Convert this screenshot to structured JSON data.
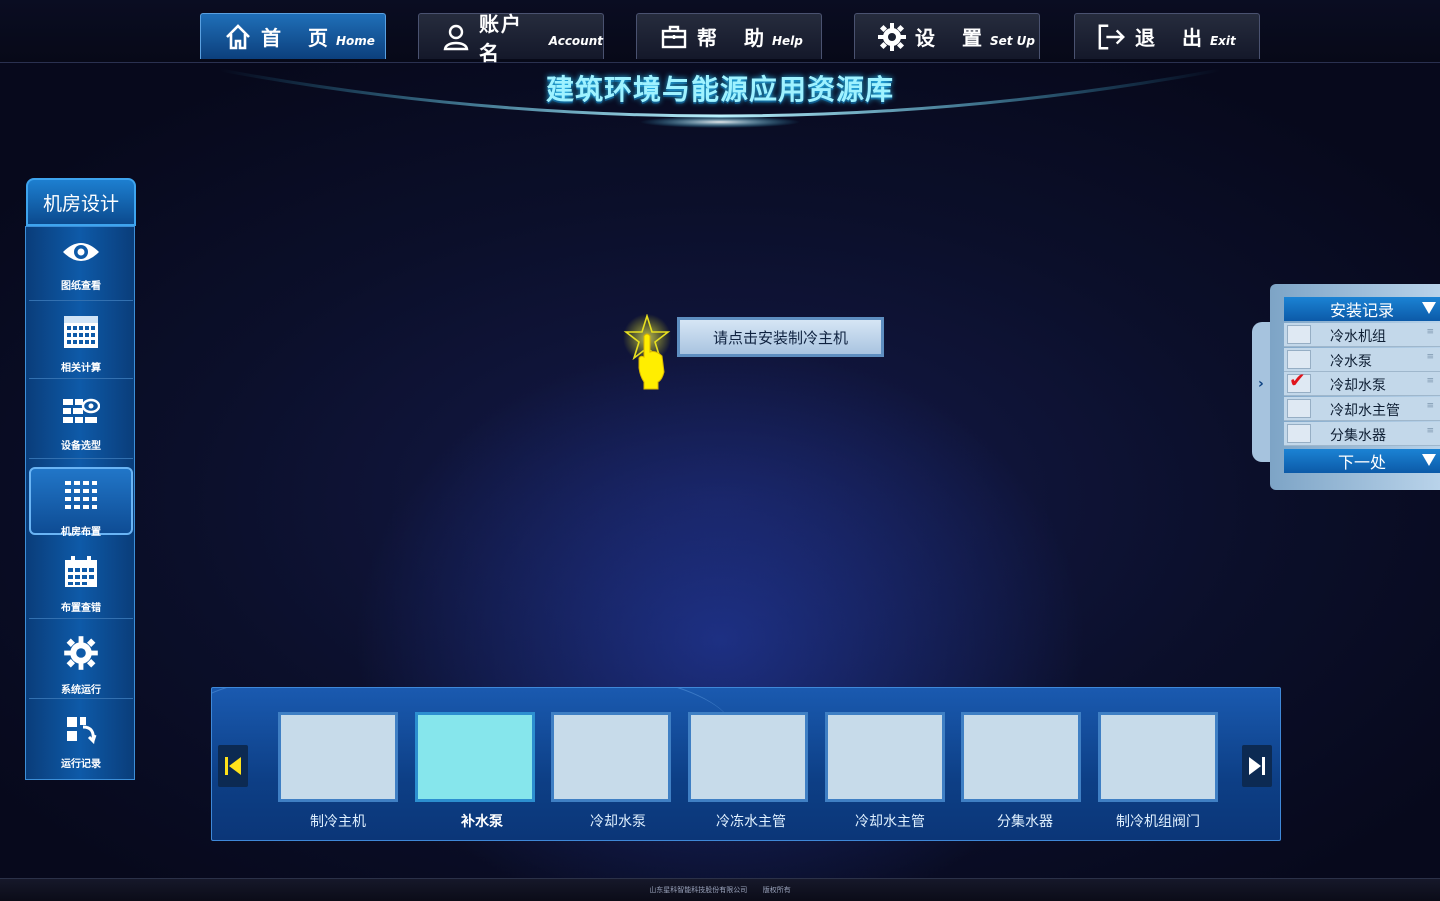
{
  "nav": {
    "items": [
      {
        "zh": "首 页",
        "en": "Home",
        "icon": "home-icon",
        "active": true
      },
      {
        "zh": "账户名",
        "en": "Account",
        "icon": "user-icon",
        "active": false
      },
      {
        "zh": "帮 助",
        "en": "Help",
        "icon": "briefcase-icon",
        "active": false
      },
      {
        "zh": "设 置",
        "en": "Set Up",
        "icon": "gear-icon",
        "active": false
      },
      {
        "zh": "退 出",
        "en": "Exit",
        "icon": "exit-icon",
        "active": false
      }
    ]
  },
  "title": "建筑环境与能源应用资源库",
  "sidebar": {
    "header": "机房设计",
    "items": [
      {
        "label": "图纸查看",
        "icon": "eye-icon"
      },
      {
        "label": "相关计算",
        "icon": "calculator-icon"
      },
      {
        "label": "设备选型",
        "icon": "equipment-select-icon"
      },
      {
        "label": "机房布置",
        "icon": "layout-grid-icon",
        "active": true
      },
      {
        "label": "布置查错",
        "icon": "calendar-icon"
      },
      {
        "label": "系统运行",
        "icon": "gear-icon"
      },
      {
        "label": "运行记录",
        "icon": "record-icon"
      }
    ]
  },
  "prompt": {
    "text": "请点击安装制冷主机",
    "icon": "pointing-hand-icon"
  },
  "install_panel": {
    "header": "安装记录",
    "rows": [
      {
        "label": "冷水机组",
        "checked": false
      },
      {
        "label": "冷水泵",
        "checked": false
      },
      {
        "label": "冷却水泵",
        "checked": true
      },
      {
        "label": "冷却水主管",
        "checked": false
      },
      {
        "label": "分集水器",
        "checked": false
      }
    ],
    "next": "下一处"
  },
  "tray": {
    "items": [
      {
        "label": "制冷主机",
        "selected": false
      },
      {
        "label": "补水泵",
        "selected": true
      },
      {
        "label": "冷却水泵",
        "selected": false
      },
      {
        "label": "冷冻水主管",
        "selected": false
      },
      {
        "label": "冷却水主管",
        "selected": false
      },
      {
        "label": "分集水器",
        "selected": false
      },
      {
        "label": "制冷机组阀门",
        "selected": false
      }
    ]
  },
  "footer": {
    "company": "山东星科智能科技股份有限公司",
    "rights": "版权所有"
  },
  "colors": {
    "accent": "#1b83d4",
    "title_glow": "#9ff2ff",
    "selected_card": "#86e6ec",
    "check": "#e0141c"
  }
}
